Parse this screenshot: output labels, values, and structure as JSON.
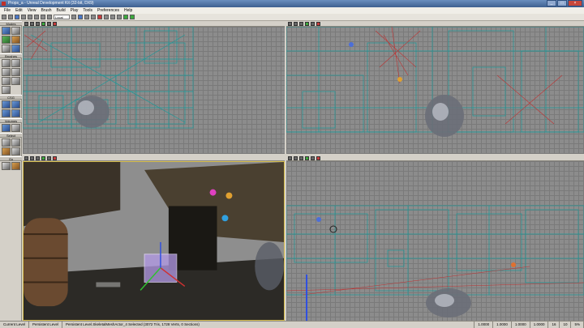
{
  "window": {
    "title": "Props_a - Unreal Development Kit (32-bit, DX9)"
  },
  "menu": [
    "File",
    "Edit",
    "View",
    "Brush",
    "Build",
    "Play",
    "Tools",
    "Preferences",
    "Help"
  ],
  "toolbar": {
    "coordinate_system": "Local"
  },
  "sidebar": {
    "modes": "Modes",
    "brushes": "Brushes",
    "csg": "CSG",
    "volumes": "Volumes",
    "select": "Select",
    "go": "Go"
  },
  "status": {
    "current_level_label": "Current Level",
    "current_level_value": "Persistent Level",
    "selection": "Persistent Level.SkeletalMeshActor_4 Selected (3072 Tris, 1728 Verts, 0 Sections)",
    "scale_x": "1.0000",
    "scale_y": "1.0000",
    "scale_z": "1.0000",
    "scale_all": "1.0000",
    "grid": "16",
    "rotation": "10",
    "percent": "5%"
  }
}
